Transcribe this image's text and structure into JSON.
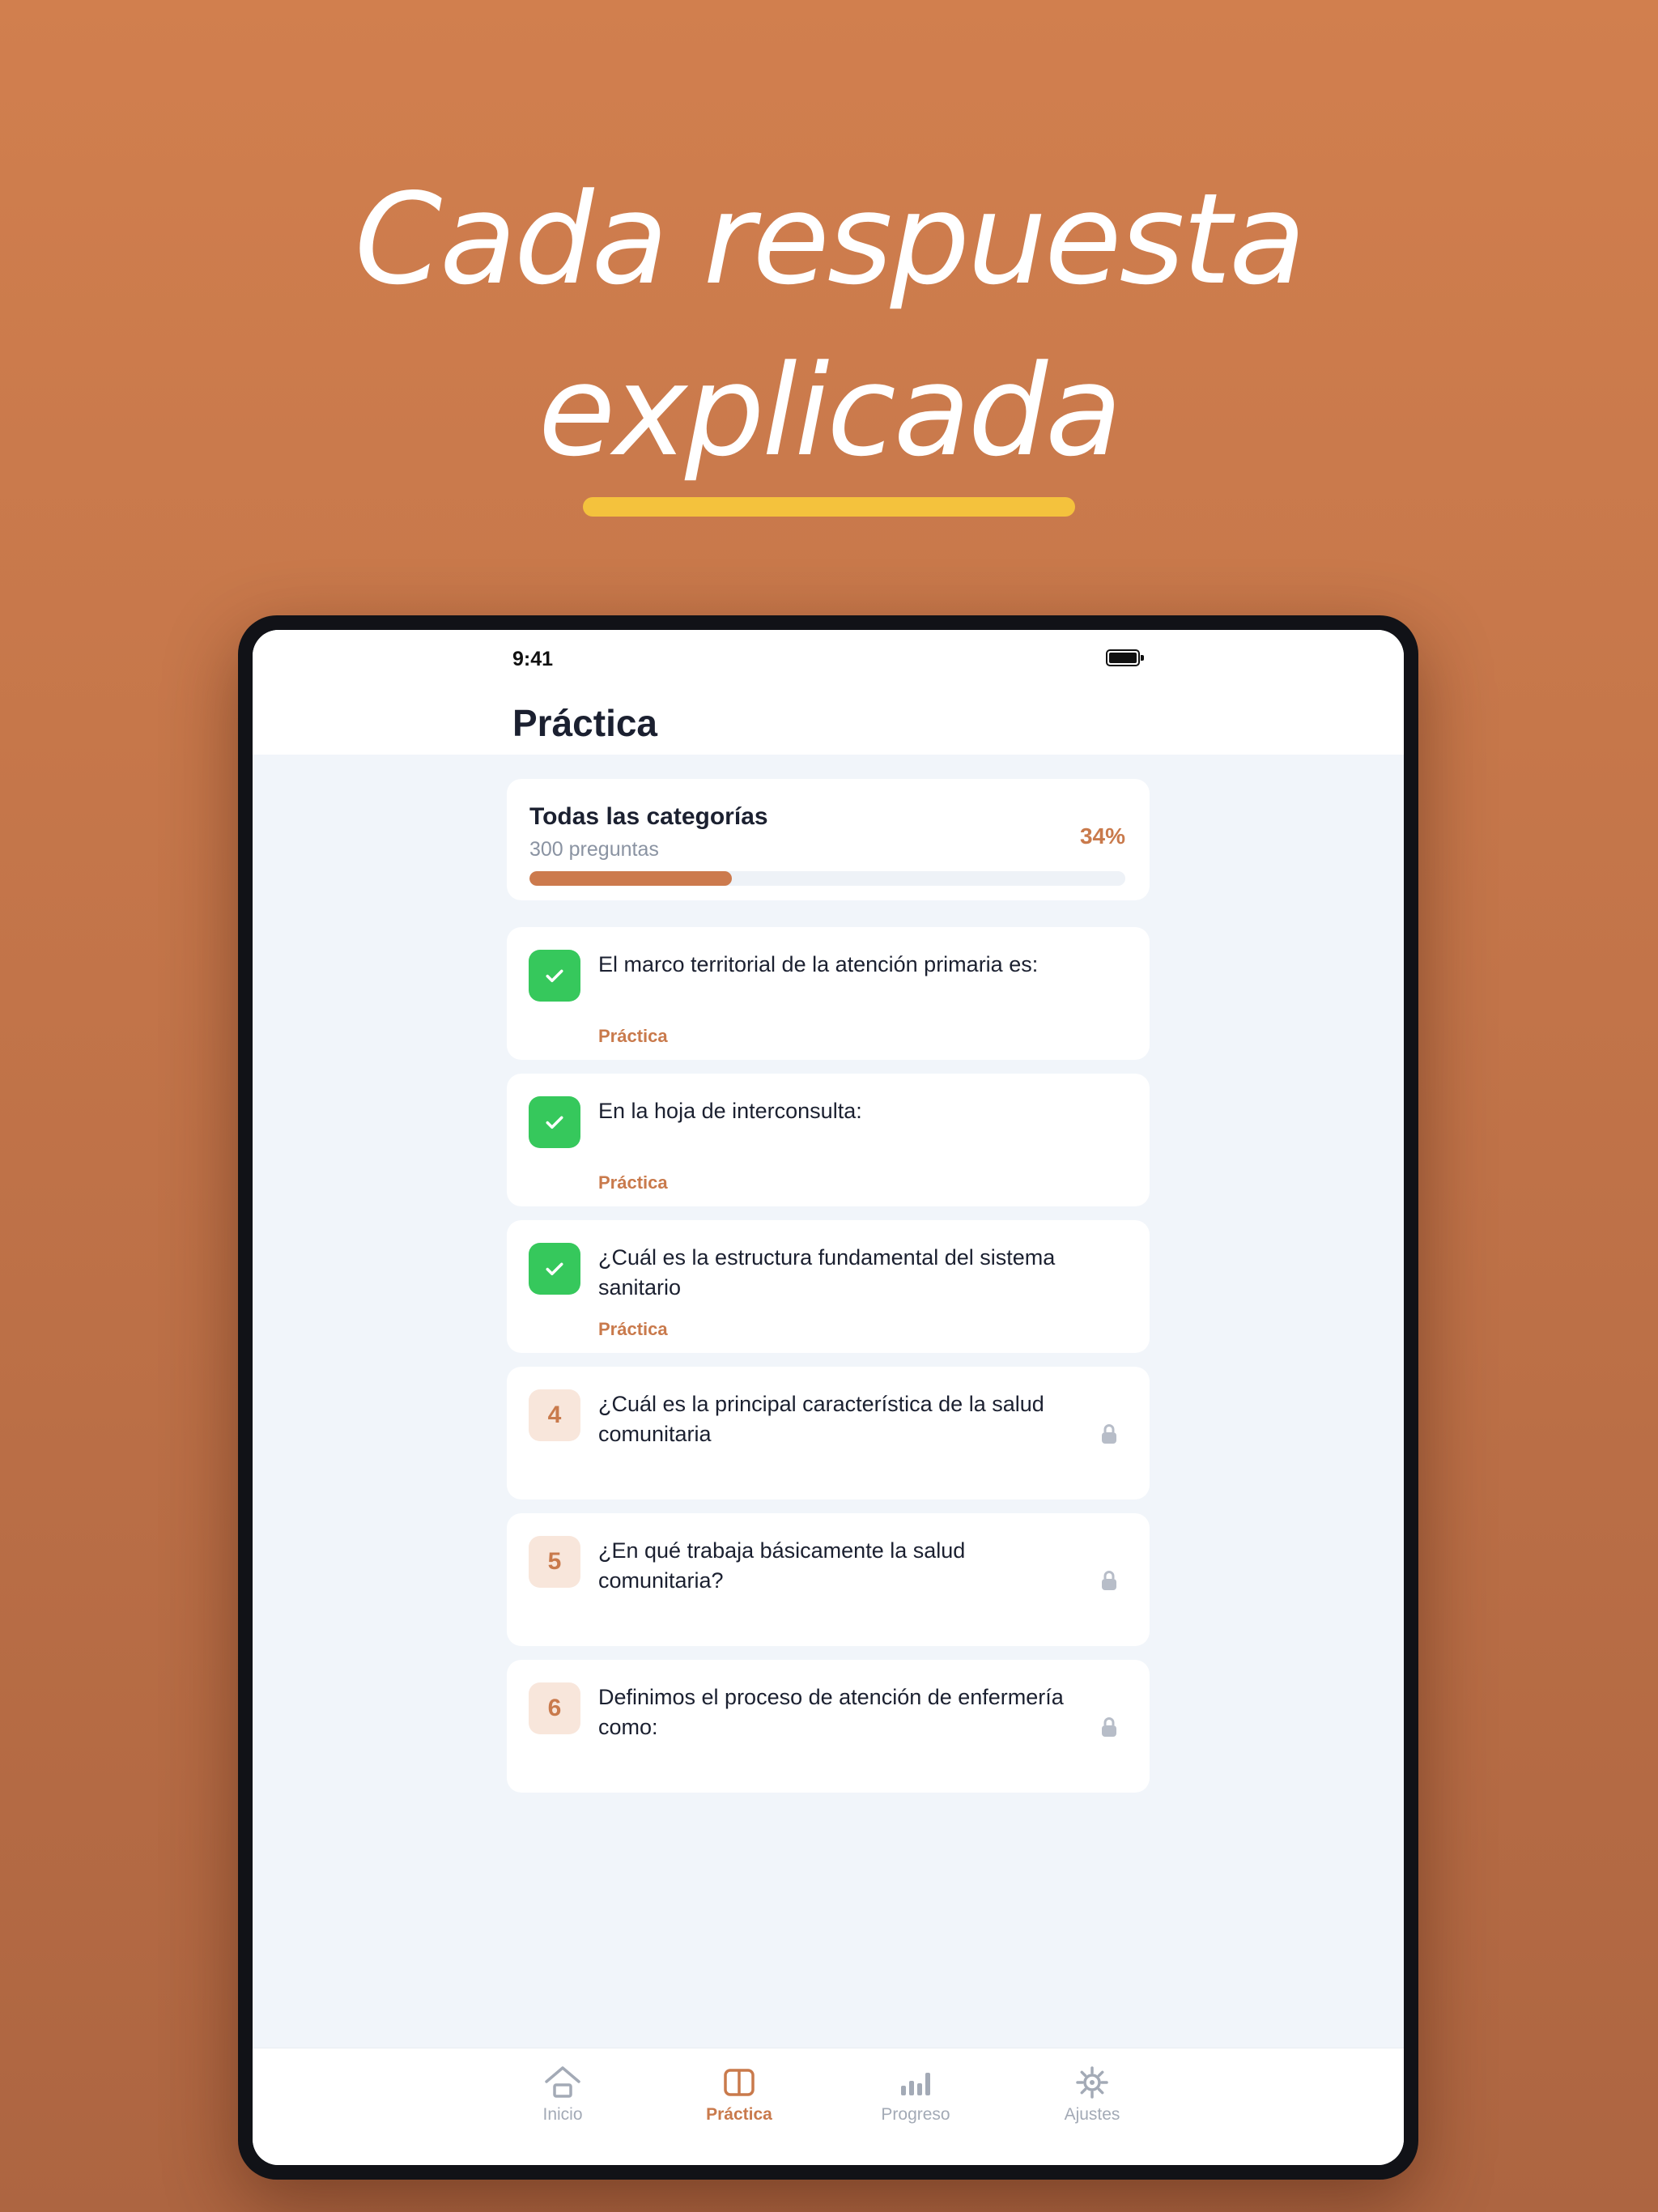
{
  "hero": {
    "line1": "Cada respuesta",
    "line2": "explicada",
    "accent_color": "#F4C23D",
    "background_color": "#C97A4C"
  },
  "status_bar": {
    "time": "9:41",
    "battery_icon": "battery-full-icon"
  },
  "page": {
    "title": "Práctica"
  },
  "summary": {
    "title": "Todas las categorías",
    "subtitle": "300 preguntas",
    "percent_label": "34%",
    "progress": 0.34
  },
  "questions": [
    {
      "status": "done",
      "icon": "check-icon",
      "text": "El marco territorial de la atención primaria es:",
      "tag": "Práctica"
    },
    {
      "status": "done",
      "icon": "check-icon",
      "text": "En la hoja de interconsulta:",
      "tag": "Práctica"
    },
    {
      "status": "done",
      "icon": "check-icon",
      "text": "¿Cuál es la estructura fundamental del sistema sanitario",
      "tag": "Práctica"
    },
    {
      "status": "locked",
      "number": "4",
      "icon": "lock-icon",
      "text": "¿Cuál es la principal característica de la salud comunitaria"
    },
    {
      "status": "locked",
      "number": "5",
      "icon": "lock-icon",
      "text": "¿En qué trabaja básicamente la salud comunitaria?"
    },
    {
      "status": "locked",
      "number": "6",
      "icon": "lock-icon",
      "text": "Definimos el proceso de atención de enfermería como:"
    }
  ],
  "tabs": [
    {
      "label": "Inicio",
      "icon": "home-icon",
      "active": false
    },
    {
      "label": "Práctica",
      "icon": "book-icon",
      "active": true
    },
    {
      "label": "Progreso",
      "icon": "bar-chart-icon",
      "active": false
    },
    {
      "label": "Ajustes",
      "icon": "gear-icon",
      "active": false
    }
  ],
  "colors": {
    "accent": "#C97A4C",
    "success": "#36C85C",
    "text_primary": "#1B2030",
    "text_secondary": "#8A93A2",
    "tab_inactive": "#A3AAB6",
    "screen_background": "#F1F5FA"
  }
}
